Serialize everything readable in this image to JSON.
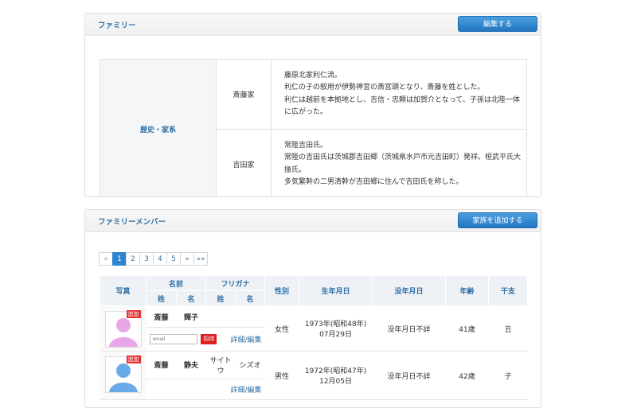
{
  "family": {
    "title": "ファミリー",
    "edit_button": "編集する",
    "row_header": "歴史・家系",
    "rows": [
      {
        "name": "斎藤家",
        "lines": [
          "藤原北家利仁流。",
          "利仁の子の叙用が伊勢神宮の斎宮頭となり、斎藤を姓とした。",
          "利仁は越前を本拠地とし、吉信・忠頼は加賀介となって、子孫は北陸一体",
          "に広がった。"
        ]
      },
      {
        "name": "吉田家",
        "lines": [
          "常陸吉田氏。",
          "常陸の吉田氏は茨城郡吉田郷（茨城県水戸市元吉田町）発祥。桓武平氏大",
          "掾氏。",
          "多気繁幹の二男清幹が吉田郷に住んで吉田氏を称した。"
        ]
      }
    ]
  },
  "members": {
    "title": "ファミリーメンバー",
    "add_button": "家族を追加する",
    "pagination": [
      "«",
      "1",
      "2",
      "3",
      "4",
      "5",
      "»",
      "»»"
    ],
    "active_page": "1",
    "headers": {
      "photo": "写真",
      "name": "名前",
      "furigana": "フリガナ",
      "sei": "姓",
      "mei": "名",
      "gender": "性別",
      "birth": "生年月日",
      "death": "没年月日",
      "age": "年齢",
      "eto": "干支"
    },
    "rows": [
      {
        "badge": "追加",
        "avatar_color": "#e8a6e8",
        "sei": "斎藤",
        "mei": "輝子",
        "kana_sei": "",
        "kana_mei": "",
        "email_placeholder": "email",
        "invite": "招待",
        "edit": "詳細/編集",
        "gender": "女性",
        "birth1": "1973年(昭和48年)",
        "birth2": "07月29日",
        "death": "没年月日不詳",
        "age": "41歳",
        "eto": "丑"
      },
      {
        "badge": "追加",
        "avatar_color": "#6aaae8",
        "sei": "斎藤",
        "mei": "静夫",
        "kana_sei": "サイト ウ",
        "kana_mei": "シズオ",
        "edit": "詳細/編集",
        "gender": "男性",
        "birth1": "1972年(昭和47年)",
        "birth2": "12月05日",
        "death": "没年月日不詳",
        "age": "42歳",
        "eto": "子"
      }
    ]
  }
}
